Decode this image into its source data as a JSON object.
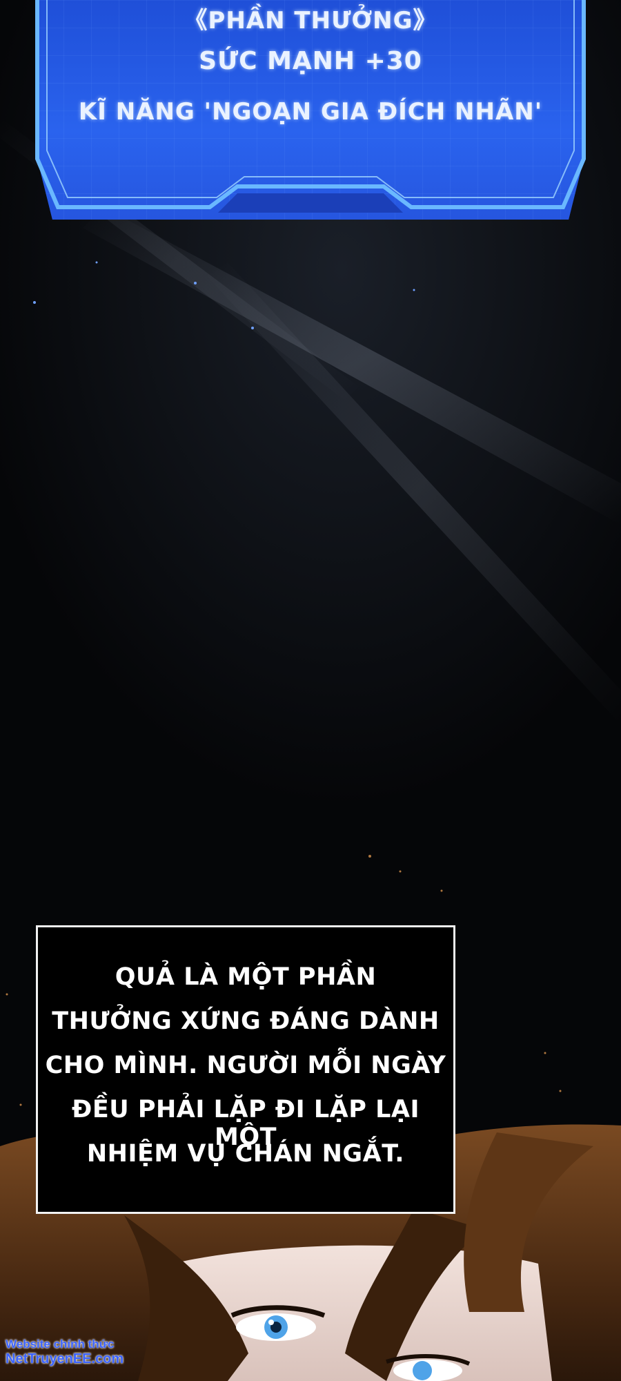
{
  "system_panel": {
    "line1": "《PHẦN THƯỞNG》",
    "line2": "SỨC MẠNH +30",
    "line3": "KĨ NĂNG 'NGOẠN GIA ĐÍCH NHÃN'"
  },
  "caption": {
    "lines": [
      "QUẢ LÀ MỘT PHẦN",
      "THƯỞNG XỨNG ĐÁNG DÀNH",
      "CHO MÌNH. NGƯỜI MỖI NGÀY",
      "ĐỀU PHẢI LẶP ĐI LẶP LẠI MỘT",
      "NHIỆM VỤ CHÁN NGẮT."
    ]
  },
  "watermark": {
    "line1": "Website chính thức",
    "line2": "NetTruyenEE.com"
  }
}
